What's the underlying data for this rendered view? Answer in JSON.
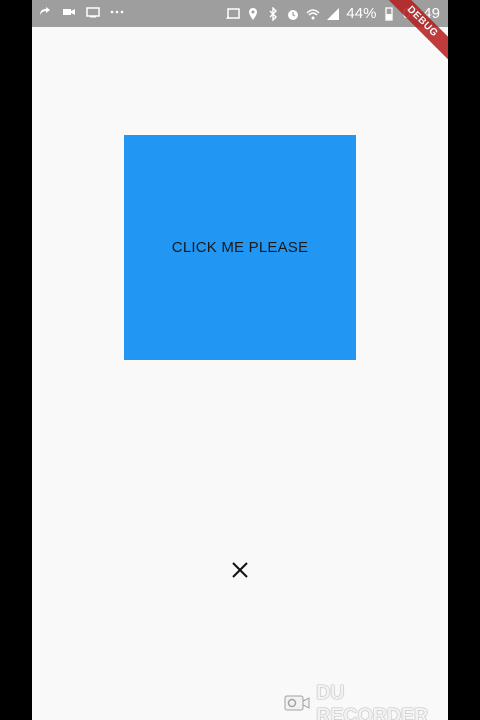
{
  "status_bar": {
    "left_icons": [
      "call-forward-icon",
      "video-icon",
      "cast-icon",
      "more-dots-icon"
    ],
    "right_icons": [
      "screen-cast-icon",
      "location-icon",
      "bluetooth-icon",
      "alarm-icon",
      "wifi-icon",
      "signal-icon"
    ],
    "battery_percent": "44%",
    "time": "00:49"
  },
  "debug_banner": "DEBUG",
  "main": {
    "button_label": "CLICK ME PLEASE",
    "button_color": "#2196f3"
  },
  "close": {
    "icon": "close-icon"
  },
  "watermark": {
    "text": "DU RECORDER"
  }
}
